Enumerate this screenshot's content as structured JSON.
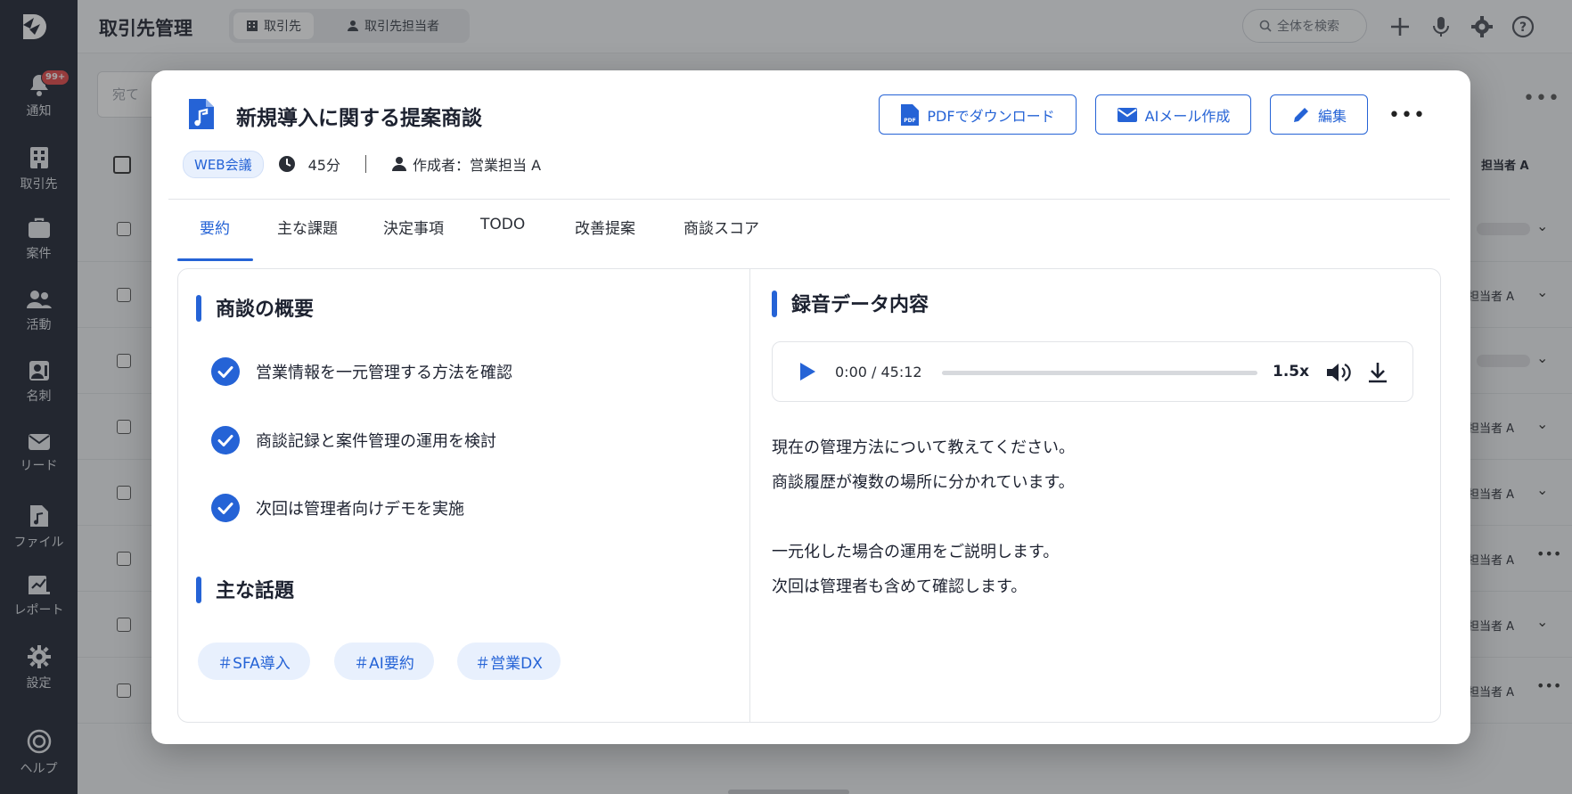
{
  "sidebar": {
    "badge": "99+",
    "items": [
      {
        "label": "通知",
        "icon": "bell-icon"
      },
      {
        "label": "取引先",
        "icon": "building-icon"
      },
      {
        "label": "案件",
        "icon": "briefcase-icon"
      },
      {
        "label": "活動",
        "icon": "people-icon"
      },
      {
        "label": "名刺",
        "icon": "contact-card-icon"
      },
      {
        "label": "リード",
        "icon": "envelope-icon"
      },
      {
        "label": "ファイル",
        "icon": "music-file-icon"
      },
      {
        "label": "レポート",
        "icon": "report-icon"
      },
      {
        "label": "設定",
        "icon": "gear-icon"
      },
      {
        "label": "ヘルプ",
        "icon": "help-icon"
      }
    ]
  },
  "app": {
    "title": "取引先管理",
    "tabs": [
      {
        "label": "取引先",
        "icon": "building-icon",
        "active": true
      },
      {
        "label": "取引先担当者",
        "icon": "person-icon",
        "active": false
      }
    ],
    "search_placeholder": "全体を検索",
    "filter_placeholder": "宛て",
    "column_header": "担当者 A",
    "row_owner": "担当者 A"
  },
  "modal": {
    "title": "新規導入に関する提案商談",
    "buttons": {
      "pdf": "PDFでダウンロード",
      "ai_mail": "AIメール作成",
      "edit": "編集"
    },
    "meta": {
      "type": "WEB会議",
      "duration": "45分",
      "author": "作成者：営業担当 A"
    },
    "tabs": [
      "要約",
      "主な課題",
      "決定事項",
      "TODO",
      "改善提案",
      "商談スコア"
    ],
    "active_tab": "要約",
    "summary": {
      "heading": "商談の概要",
      "items": [
        "営業情報を一元管理する方法を確認",
        "商談記録と案件管理の運用を検討",
        "次回は管理者向けデモを実施"
      ]
    },
    "topics": {
      "heading": "主な話題",
      "tags": [
        "＃SFA導入",
        "＃AI要約",
        "＃営業DX"
      ]
    },
    "recording": {
      "heading": "録音データ内容",
      "time": "0:00 / 45:12",
      "progress": 0,
      "speed": "1.5x",
      "transcript": [
        "現在の管理方法について教えてください。",
        "商談履歴が複数の場所に分かれています。",
        "",
        "一元化した場合の運用をご説明します。",
        "次回は管理者も含めて確認します。"
      ]
    }
  },
  "colors": {
    "accent": "#2563d6",
    "sidebar_bg": "#1f2532",
    "badge": "#e54848",
    "chip_bg": "#e8f0fd"
  }
}
